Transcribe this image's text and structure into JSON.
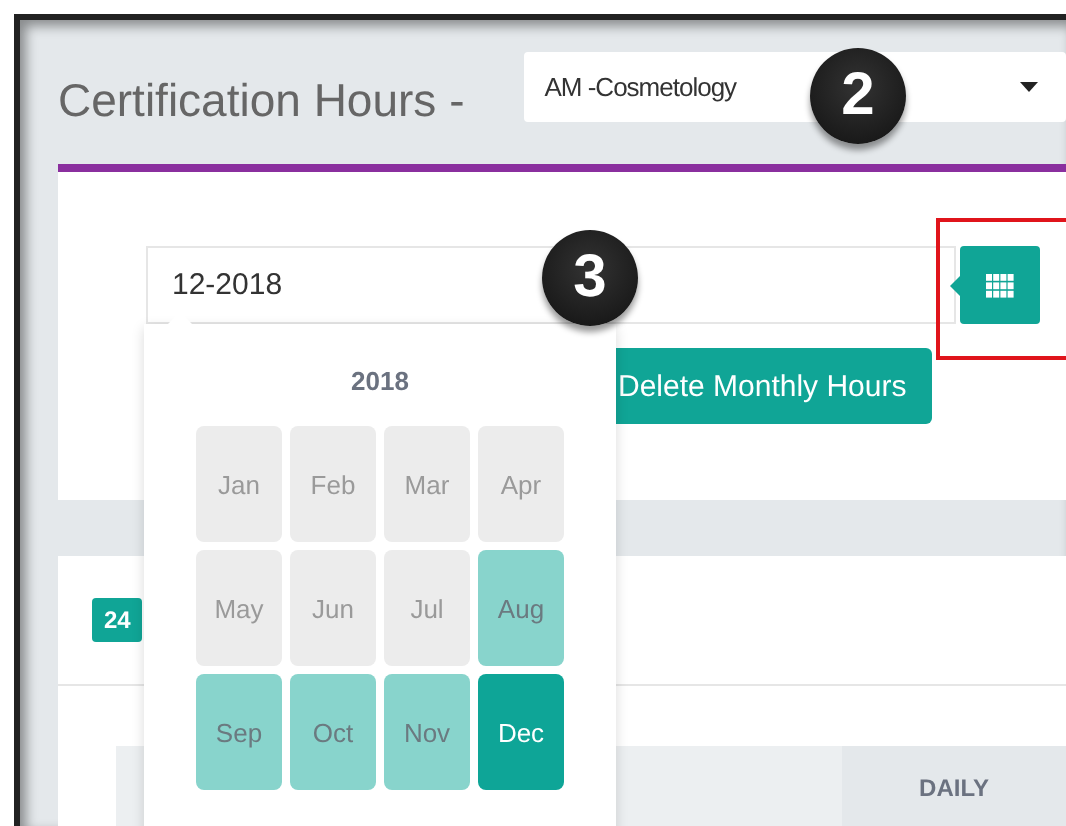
{
  "header": {
    "title": "Certification Hours -",
    "program_select": {
      "value": "AM -Cosmetology"
    }
  },
  "callouts": [
    "2",
    "3"
  ],
  "month_field": {
    "value": "12-2018",
    "highlighted": true
  },
  "delete_button": "Delete Monthly Hours",
  "month_picker": {
    "year": "2018",
    "months": [
      {
        "label": "Jan",
        "disabled": true,
        "selected": false
      },
      {
        "label": "Feb",
        "disabled": true,
        "selected": false
      },
      {
        "label": "Mar",
        "disabled": true,
        "selected": false
      },
      {
        "label": "Apr",
        "disabled": true,
        "selected": false
      },
      {
        "label": "May",
        "disabled": true,
        "selected": false
      },
      {
        "label": "Jun",
        "disabled": true,
        "selected": false
      },
      {
        "label": "Jul",
        "disabled": true,
        "selected": false
      },
      {
        "label": "Aug",
        "disabled": false,
        "selected": false
      },
      {
        "label": "Sep",
        "disabled": false,
        "selected": false
      },
      {
        "label": "Oct",
        "disabled": false,
        "selected": false
      },
      {
        "label": "Nov",
        "disabled": false,
        "selected": false
      },
      {
        "label": "Dec",
        "disabled": false,
        "selected": true
      }
    ]
  },
  "badge": "24",
  "table": {
    "columns": [
      "DAILY"
    ]
  }
}
